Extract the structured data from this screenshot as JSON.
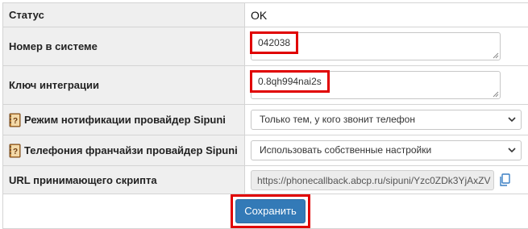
{
  "rows": {
    "status": {
      "label": "Статус",
      "value": "OK"
    },
    "system_number": {
      "label": "Номер в системе",
      "value": "042038"
    },
    "integration_key": {
      "label": "Ключ интеграции",
      "value": "0.8qh994nai2s"
    },
    "notify_mode": {
      "label": "Режим нотификации провайдер Sipuni",
      "selected": "Только тем, у кого звонит телефон",
      "help_icon": "book-help-icon"
    },
    "franchise_telephony": {
      "label": "Телефония франчайзи провайдер Sipuni",
      "selected": "Использовать собственные настройки",
      "help_icon": "book-help-icon"
    },
    "script_url": {
      "label": "URL принимающего скрипта",
      "value": "https://phonecallback.abcp.ru/sipuni/Yzc0ZDk3YjAxZV",
      "copy_icon": "copy-icon"
    }
  },
  "actions": {
    "save_label": "Сохранить"
  },
  "colors": {
    "label_bg": "#efefef",
    "border": "#d4d4d4",
    "highlight": "#e00000",
    "primary_button": "#337ab7",
    "readonly_bg": "#ececec"
  }
}
